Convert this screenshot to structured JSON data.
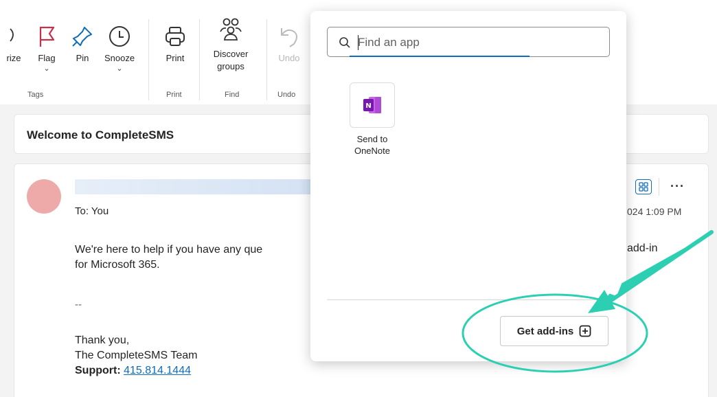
{
  "ribbon": {
    "partial_label": "rize",
    "flag": {
      "label": "Flag",
      "chevron": "⌄"
    },
    "pin": {
      "label": "Pin"
    },
    "snooze": {
      "label": "Snooze",
      "chevron": "⌄"
    },
    "print": {
      "label": "Print"
    },
    "discover": {
      "label_line1": "Discover",
      "label_line2": "groups"
    },
    "undo": {
      "label": "Undo"
    },
    "groups": {
      "tags": "Tags",
      "print": "Print",
      "find": "Find",
      "undo": "Undo"
    },
    "icons": [
      "flag-icon",
      "pin-icon",
      "clock-icon",
      "printer-icon",
      "people-icon",
      "undo-icon"
    ]
  },
  "email": {
    "subject": "Welcome to CompleteSMS",
    "to": "To: You",
    "body_line1": "We're here to help if you have any que",
    "body_line1_right": "add-in",
    "body_line2": "for Microsoft 365.",
    "dashes": "--",
    "sig_line1": "Thank you,",
    "sig_line2": "The CompleteSMS Team",
    "support_label": "Support:",
    "support_phone": "415.814.1444",
    "date_partial": "024 1:09 PM",
    "more": "···"
  },
  "popup": {
    "search_placeholder": "Find an app",
    "apps": [
      {
        "name_line1": "Send to",
        "name_line2": "OneNote",
        "icon": "onenote-icon"
      }
    ],
    "get_addins_label": "Get add-ins"
  },
  "colors": {
    "accent": "#0f6cbd",
    "flag_red": "#c4314b",
    "onenote_purple": "#7719aa",
    "annotation_teal": "#2ccfb2"
  }
}
